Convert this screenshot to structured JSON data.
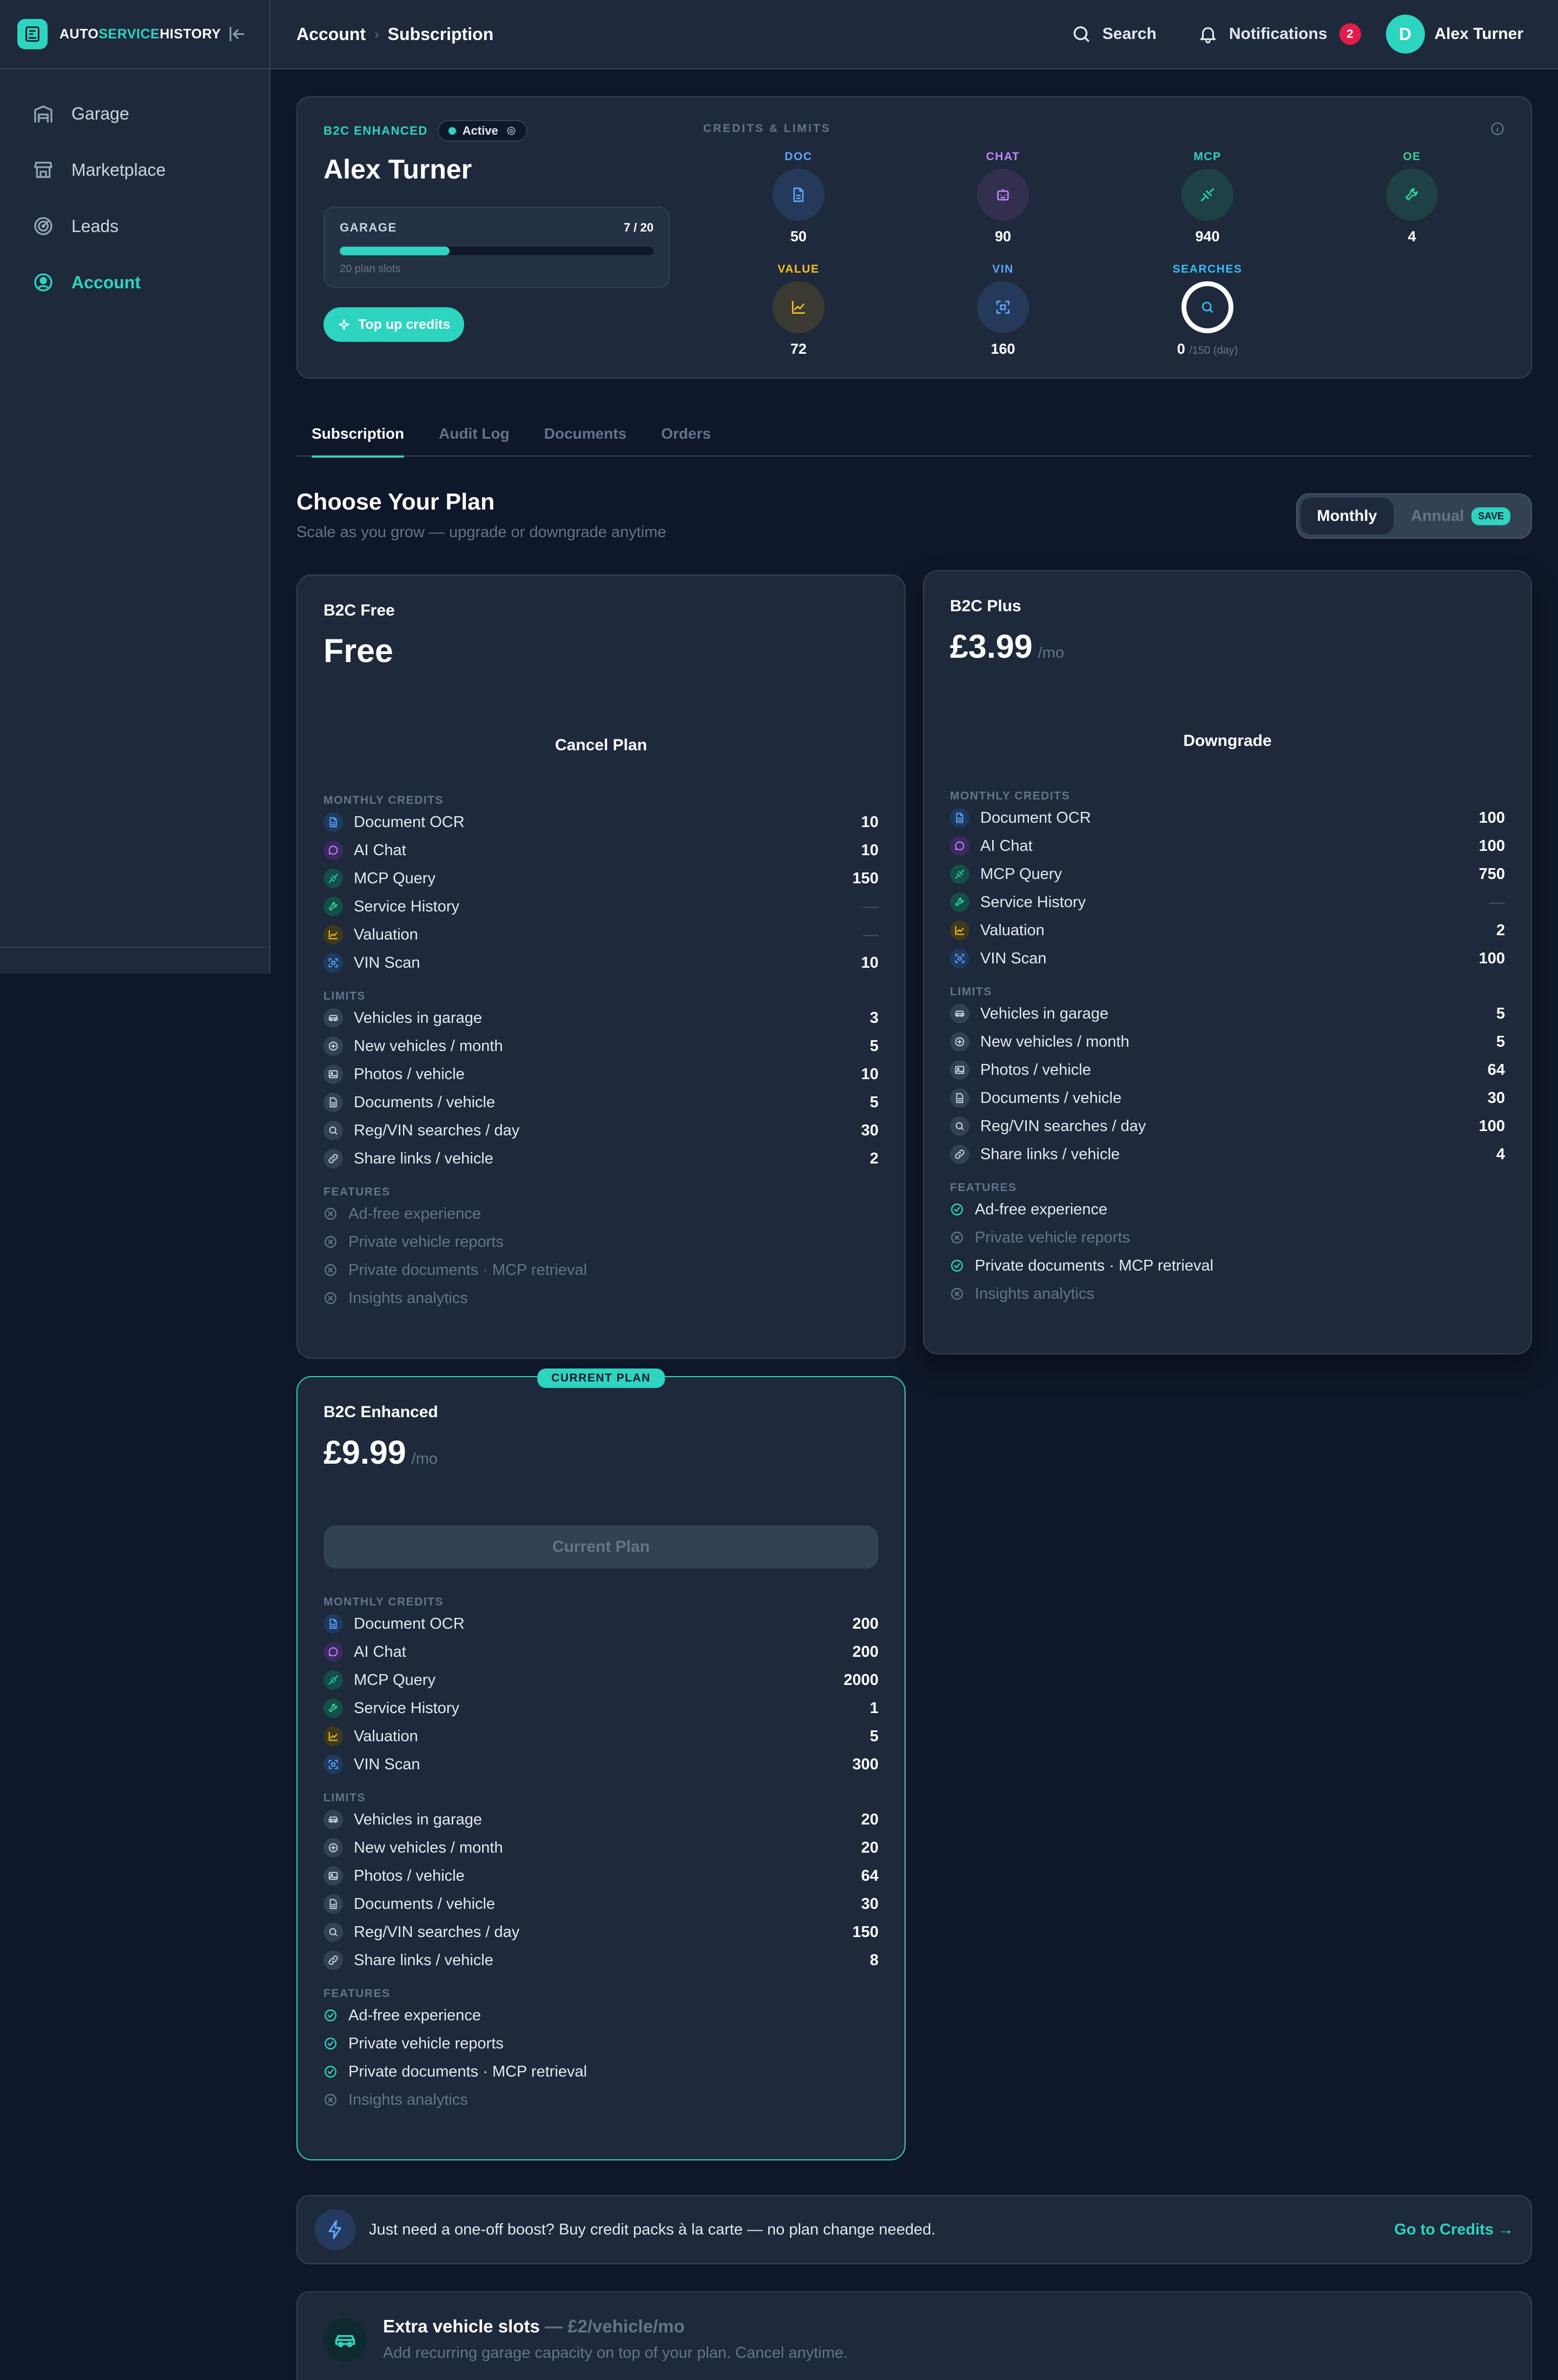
{
  "brand": {
    "part1": "AUTO",
    "part2": "SERVICE",
    "part3": "HISTORY"
  },
  "sidebar": {
    "items": [
      {
        "label": "Garage",
        "icon": "garage-icon"
      },
      {
        "label": "Marketplace",
        "icon": "store-icon"
      },
      {
        "label": "Leads",
        "icon": "target-icon"
      },
      {
        "label": "Account",
        "icon": "user-circle-icon",
        "active": true
      }
    ]
  },
  "header": {
    "breadcrumb": [
      "Account",
      "Subscription"
    ],
    "search_label": "Search",
    "notifications_label": "Notifications",
    "notifications_count": "2",
    "user_initial": "D",
    "user_name": "Alex Turner"
  },
  "account": {
    "plan_tag": "B2C ENHANCED",
    "status": "Active",
    "name": "Alex Turner",
    "garage_label": "GARAGE",
    "garage_count": "7 / 20",
    "garage_fill": 0.35,
    "garage_sub": "20 plan slots",
    "topup_label": "Top up credits",
    "credits_title": "CREDITS & LIMITS",
    "credits": [
      {
        "label": "DOC",
        "value": "50",
        "color": "#60a5fa",
        "icon": "document-icon"
      },
      {
        "label": "CHAT",
        "value": "90",
        "color": "#c084fc",
        "icon": "chat-icon"
      },
      {
        "label": "MCP",
        "value": "940",
        "color": "#2dd4bf",
        "icon": "plug-icon"
      },
      {
        "label": "OE",
        "value": "4",
        "color": "#34d399",
        "icon": "wrench-icon"
      },
      {
        "label": "VALUE",
        "value": "72",
        "color": "#fbbf24",
        "icon": "chart-icon"
      },
      {
        "label": "VIN",
        "value": "160",
        "color": "#60a5fa",
        "icon": "scan-icon"
      },
      {
        "label": "SEARCHES",
        "value": "0",
        "suffix": "/150 (day)",
        "color": "#38bdf8",
        "icon": "search-icon"
      }
    ]
  },
  "tabs": [
    "Subscription",
    "Audit Log",
    "Documents",
    "Orders"
  ],
  "plans_header": {
    "title": "Choose Your Plan",
    "subtitle": "Scale as you grow — upgrade or downgrade anytime",
    "toggle_monthly": "Monthly",
    "toggle_annual": "Annual",
    "save_badge": "SAVE"
  },
  "section_labels": {
    "credits": "MONTHLY CREDITS",
    "limits": "LIMITS",
    "features": "FEATURES"
  },
  "credit_names": [
    "Document OCR",
    "AI Chat",
    "MCP Query",
    "Service History",
    "Valuation",
    "VIN Scan"
  ],
  "limit_names": [
    "Vehicles in garage",
    "New vehicles / month",
    "Photos / vehicle",
    "Documents / vehicle",
    "Reg/VIN searches / day",
    "Share links / vehicle"
  ],
  "feature_names": [
    "Ad-free experience",
    "Private vehicle reports",
    "Private documents · MCP retrieval",
    "Insights analytics"
  ],
  "plans": [
    {
      "name": "B2C Free",
      "price": "Free",
      "per": "",
      "cta": "Cancel Plan",
      "credits": [
        "10",
        "10",
        "150",
        "—",
        "—",
        "10"
      ],
      "limits": [
        "3",
        "5",
        "10",
        "5",
        "30",
        "2"
      ],
      "features": [
        false,
        false,
        false,
        false
      ]
    },
    {
      "name": "B2C Plus",
      "price": "£3.99",
      "per": "/mo",
      "cta": "Downgrade",
      "credits": [
        "100",
        "100",
        "750",
        "—",
        "2",
        "100"
      ],
      "limits": [
        "5",
        "5",
        "64",
        "30",
        "100",
        "4"
      ],
      "features": [
        true,
        false,
        true,
        false
      ]
    },
    {
      "name": "B2C Enhanced",
      "price": "£9.99",
      "per": "/mo",
      "cta": "Current Plan",
      "badge": "CURRENT PLAN",
      "credits": [
        "200",
        "200",
        "2000",
        "1",
        "5",
        "300"
      ],
      "limits": [
        "20",
        "20",
        "64",
        "30",
        "150",
        "8"
      ],
      "features": [
        true,
        true,
        true,
        false
      ]
    }
  ],
  "boost": {
    "text": "Just need a one-off boost? Buy credit packs à la carte — no plan change needed.",
    "link": "Go to Credits →"
  },
  "extra": {
    "title": "Extra vehicle slots",
    "price": " — £2/vehicle/mo",
    "subtitle": "Add recurring garage capacity on top of your plan. Cancel anytime."
  },
  "colors": {
    "accent": "#2dd4bf",
    "background": "#0f172a",
    "card": "#1e293b",
    "badge_red": "#e11d48"
  }
}
